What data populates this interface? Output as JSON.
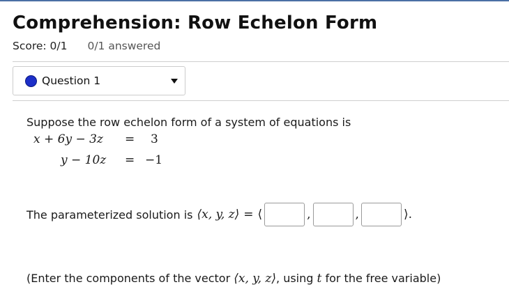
{
  "page": {
    "title": "Comprehension: Row Echelon Form",
    "score": "Score: 0/1",
    "answered": "0/1 answered"
  },
  "question_select": {
    "label": "Question 1"
  },
  "problem": {
    "intro": "Suppose the row echelon form of a system of equations is",
    "equations": [
      {
        "lhs": "x + 6y − 3z",
        "eq": "=",
        "rhs": "3"
      },
      {
        "lhs": "y − 10z",
        "eq": "=",
        "rhs": "−1"
      }
    ],
    "param_prefix": "The parameterized solution is",
    "vector": "⟨x, y, z⟩",
    "equals": "=",
    "open_angle": "⟨",
    "close_angle": "⟩.",
    "comma": ",",
    "inputs": [
      {
        "value": "",
        "placeholder": ""
      },
      {
        "value": "",
        "placeholder": ""
      },
      {
        "value": "",
        "placeholder": ""
      }
    ],
    "note_prefix": "(Enter the components of the vector",
    "note_vector": "⟨x, y, z⟩",
    "note_middle": ", using",
    "note_var": "t",
    "note_suffix": "for the free variable)"
  },
  "colors": {
    "accent_bar": "#4a6fa5",
    "question_dot": "#1c2fc8"
  }
}
